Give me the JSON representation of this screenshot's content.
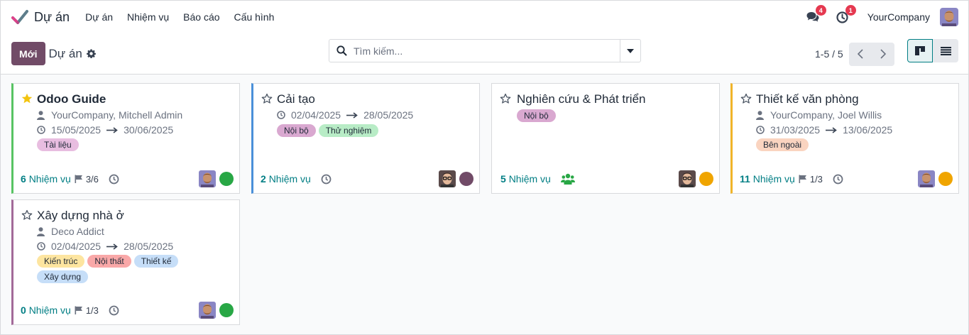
{
  "navbar": {
    "app_name": "Dự án",
    "menu": [
      {
        "label": "Dự án"
      },
      {
        "label": "Nhiệm vụ"
      },
      {
        "label": "Báo cáo"
      },
      {
        "label": "Cấu hình"
      }
    ],
    "messages_badge": "4",
    "activities_badge": "1",
    "company": "YourCompany",
    "colors": {
      "brand_accent": "#714b67",
      "badge": "#e53950"
    }
  },
  "control_panel": {
    "new_label": "Mới",
    "title": "Dự án",
    "search_placeholder": "Tìm kiếm...",
    "pager": "1-5 / 5"
  },
  "projects": [
    {
      "name": "Odoo Guide",
      "favorite": true,
      "customer": "YourCompany, Mitchell Admin",
      "date_start": "15/05/2025",
      "date_end": "30/06/2025",
      "tags": [
        {
          "label": "Tài liệu",
          "color": "#e8bde0"
        }
      ],
      "tasks_count": "6",
      "tasks_label": "Nhiệm vụ",
      "milestones": "3/6",
      "status_color": "#28a745",
      "border_color": "#58c463"
    },
    {
      "name": "Cải tạo",
      "favorite": false,
      "date_start": "02/04/2025",
      "date_end": "28/05/2025",
      "tags": [
        {
          "label": "Nội bộ",
          "color": "#d9a8d0"
        },
        {
          "label": "Thử nghiệm",
          "color": "#b8ecc6"
        }
      ],
      "tasks_count": "2",
      "tasks_label": "Nhiệm vụ",
      "status_color": "#714b67",
      "border_color": "#4a90d9"
    },
    {
      "name": "Nghiên cứu & Phát triển",
      "favorite": false,
      "tags": [
        {
          "label": "Nội bộ",
          "color": "#d9a8d0"
        }
      ],
      "tasks_count": "5",
      "tasks_label": "Nhiệm vụ",
      "status_color": "#f0a500",
      "border_color": "#d8dadd"
    },
    {
      "name": "Thiết kế văn phòng",
      "favorite": false,
      "customer": "YourCompany, Joel Willis",
      "date_start": "31/03/2025",
      "date_end": "13/06/2025",
      "tags": [
        {
          "label": "Bên ngoài",
          "color": "#fad4c0"
        }
      ],
      "tasks_count": "11",
      "tasks_label": "Nhiệm vụ",
      "milestones": "1/3",
      "status_color": "#f0a500",
      "border_color": "#f0b429"
    },
    {
      "name": "Xây dựng nhà ở",
      "favorite": false,
      "customer": "Deco Addict",
      "date_start": "02/04/2025",
      "date_end": "28/05/2025",
      "tags": [
        {
          "label": "Kiến trúc",
          "color": "#fde5a0"
        },
        {
          "label": "Nội thất",
          "color": "#f9a8a8"
        },
        {
          "label": "Thiết kế",
          "color": "#c6def8"
        },
        {
          "label": "Xây dựng",
          "color": "#c6def8"
        }
      ],
      "tasks_count": "0",
      "tasks_label": "Nhiệm vụ",
      "milestones": "1/3",
      "status_color": "#28a745",
      "border_color": "#a36a99"
    }
  ]
}
